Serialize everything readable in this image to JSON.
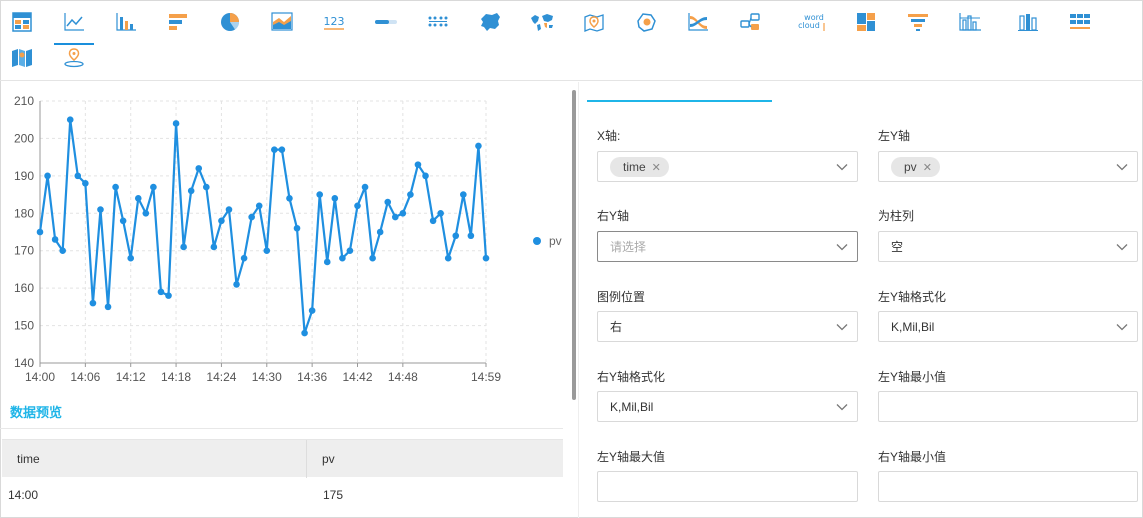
{
  "toolbar": {
    "icons": [
      {
        "name": "table-chart-icon"
      },
      {
        "name": "line-chart-icon",
        "active": true
      },
      {
        "name": "bar-chart-icon"
      },
      {
        "name": "horizontal-bar-chart-icon"
      },
      {
        "name": "pie-chart-icon"
      },
      {
        "name": "area-chart-icon"
      },
      {
        "name": "kpi-number-icon",
        "label": "123"
      },
      {
        "name": "progress-bar-icon"
      },
      {
        "name": "dot-matrix-icon"
      },
      {
        "name": "china-map-icon"
      },
      {
        "name": "world-map-icon"
      },
      {
        "name": "location-map-icon"
      },
      {
        "name": "region-map-icon"
      },
      {
        "name": "sankey-chart-icon"
      },
      {
        "name": "flow-chart-icon"
      },
      {
        "name": "word-cloud-icon",
        "label1": "word",
        "label2": "cloud"
      },
      {
        "name": "treemap-icon"
      },
      {
        "name": "funnel-chart-icon"
      },
      {
        "name": "histogram-icon"
      },
      {
        "name": "stacked-bar-icon"
      },
      {
        "name": "cross-table-icon"
      },
      {
        "name": "folded-map-icon"
      },
      {
        "name": "pin-location-icon"
      }
    ],
    "accent": "#1a8fdc",
    "orange": "#f5a04a",
    "blue": "#2f90d4"
  },
  "chart_data": {
    "type": "line",
    "title": "",
    "xlabel": "",
    "ylabel": "",
    "ylim": [
      140,
      210
    ],
    "yticks": [
      "210",
      "200",
      "190",
      "180",
      "170",
      "160",
      "150",
      "140"
    ],
    "xticks": [
      {
        "label": "14:00",
        "x": 0
      },
      {
        "label": "14:06",
        "x": 6
      },
      {
        "label": "14:12",
        "x": 12
      },
      {
        "label": "14:18",
        "x": 18
      },
      {
        "label": "14:24",
        "x": 24
      },
      {
        "label": "14:30",
        "x": 30
      },
      {
        "label": "14:36",
        "x": 36
      },
      {
        "label": "14:42",
        "x": 42
      },
      {
        "label": "14:48",
        "x": 48
      },
      {
        "label": "14:59",
        "x": 59
      }
    ],
    "legend_position": "right",
    "color": "#1f8fe0",
    "series": [
      {
        "name": "pv",
        "values": [
          175,
          190,
          173,
          170,
          205,
          190,
          188,
          156,
          181,
          155,
          187,
          178,
          168,
          184,
          180,
          187,
          159,
          158,
          204,
          171,
          186,
          192,
          187,
          171,
          178,
          181,
          161,
          168,
          179,
          182,
          170,
          197,
          197,
          184,
          176,
          148,
          154,
          185,
          167,
          184,
          168,
          170,
          182,
          187,
          168,
          175,
          183,
          179,
          180,
          185,
          193,
          190,
          178,
          180,
          168,
          174,
          185,
          174,
          198,
          168
        ]
      }
    ]
  },
  "preview": {
    "title": "数据预览",
    "columns": [
      "time",
      "pv"
    ],
    "rows": [
      [
        "14:00",
        "175"
      ]
    ]
  },
  "config": {
    "fields": [
      {
        "label": "X轴:",
        "type": "tag",
        "value": "time"
      },
      {
        "label": "左Y轴",
        "type": "tag",
        "value": "pv"
      },
      {
        "label": "右Y轴",
        "type": "placeholder",
        "value": "请选择"
      },
      {
        "label": "为柱列",
        "type": "select",
        "value": "空"
      },
      {
        "label": "图例位置",
        "type": "select",
        "value": "右"
      },
      {
        "label": "左Y轴格式化",
        "type": "select",
        "value": "K,Mil,Bil"
      },
      {
        "label": "右Y轴格式化",
        "type": "select",
        "value": "K,Mil,Bil"
      },
      {
        "label": "左Y轴最小值",
        "type": "input",
        "value": ""
      },
      {
        "label": "左Y轴最大值",
        "type": "input",
        "value": ""
      },
      {
        "label": "右Y轴最小值",
        "type": "input",
        "value": ""
      }
    ]
  }
}
